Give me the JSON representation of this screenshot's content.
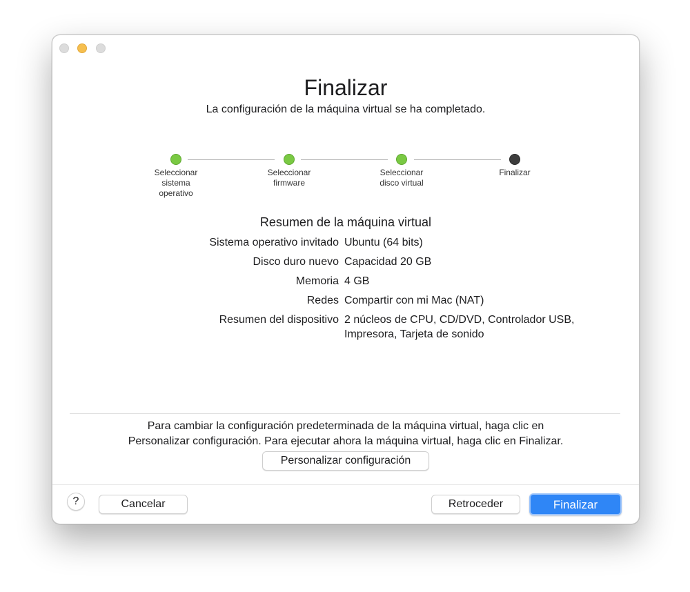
{
  "window": {
    "title": "Finalizar",
    "subtitle": "La configuración de la máquina virtual se ha completado."
  },
  "steps": [
    {
      "label": "Seleccionar\nsistema\noperativo",
      "state": "done"
    },
    {
      "label": "Seleccionar\nfirmware",
      "state": "done"
    },
    {
      "label": "Seleccionar\ndisco virtual",
      "state": "done"
    },
    {
      "label": "Finalizar",
      "state": "current"
    }
  ],
  "summary": {
    "heading": "Resumen de la máquina virtual",
    "rows": [
      {
        "label": "Sistema operativo invitado",
        "value": "Ubuntu (64 bits)"
      },
      {
        "label": "Disco duro nuevo",
        "value": "Capacidad 20 GB"
      },
      {
        "label": "Memoria",
        "value": "4 GB"
      },
      {
        "label": "Redes",
        "value": "Compartir con mi Mac (NAT)"
      },
      {
        "label": "Resumen del dispositivo",
        "value": "2 núcleos de CPU, CD/DVD, Controlador USB, Impresora, Tarjeta de sonido"
      }
    ]
  },
  "info": {
    "line1": "Para cambiar la configuración predeterminada de la máquina virtual, haga clic en",
    "line2": "Personalizar configuración. Para ejecutar ahora la máquina virtual, haga clic en Finalizar.",
    "customize_label": "Personalizar configuración"
  },
  "footer": {
    "help_label": "?",
    "cancel_label": "Cancelar",
    "back_label": "Retroceder",
    "finish_label": "Finalizar"
  },
  "colors": {
    "step_done": "#7ac943",
    "step_current": "#3d3d3d",
    "primary_button": "#2f86f6"
  }
}
